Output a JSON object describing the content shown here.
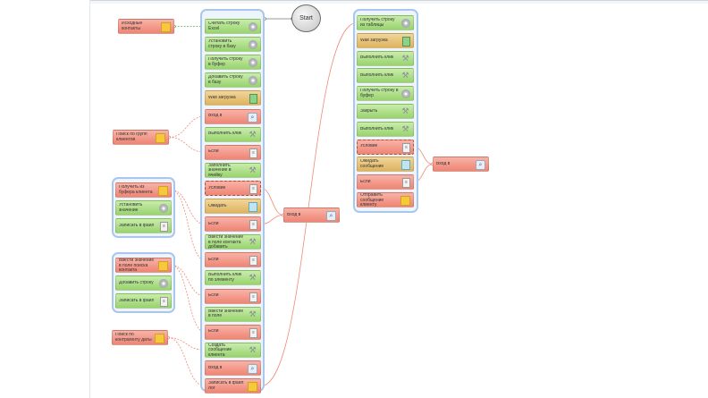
{
  "start": {
    "label": "Start"
  },
  "colors": {
    "green": "#a9dc7f",
    "red": "#f39385",
    "orange": "#e8c47a",
    "group_border": "#a9c7ea",
    "connector": "#f08a7a"
  },
  "left_notes": [
    {
      "id": "n1",
      "label": "Исходные контакты",
      "icon": "note-icon"
    },
    {
      "id": "n2",
      "label": "Поиск по групп клиентов",
      "icon": "note-icon"
    },
    {
      "id": "n3",
      "label": "Поиск по контрагенту даты",
      "icon": "note-icon"
    }
  ],
  "left_groups": [
    {
      "id": "g1",
      "items": [
        {
          "label": "Получить из буфера клиента",
          "color": "red",
          "icon": "note-icon"
        },
        {
          "label": "Установить значение",
          "color": "green",
          "icon": "disc-icon"
        },
        {
          "label": "Записать в файл",
          "color": "green",
          "icon": "document-icon"
        }
      ]
    },
    {
      "id": "g2",
      "items": [
        {
          "label": "Ввести значение в поле поиска контакта",
          "color": "red",
          "icon": "note-icon"
        },
        {
          "label": "Добавить строку",
          "color": "green",
          "icon": "disc-icon"
        },
        {
          "label": "Записать в файл",
          "color": "green",
          "icon": "document-icon"
        }
      ]
    }
  ],
  "main_column": [
    {
      "label": "Считать строку Excel",
      "color": "green",
      "icon": "disc-icon"
    },
    {
      "label": "Установить строку в базу",
      "color": "green",
      "icon": "disc-icon"
    },
    {
      "label": "Получить строку в буфер",
      "color": "green",
      "icon": "disc-icon"
    },
    {
      "label": "Добавить строку в базу",
      "color": "green",
      "icon": "disc-icon"
    },
    {
      "label": "Wait загрузка",
      "color": "orange",
      "icon": "drive-icon"
    },
    {
      "label": "Вход в",
      "color": "red",
      "icon": "search-icon"
    },
    {
      "label": "Выполнить клик",
      "color": "green",
      "icon": "wrench-icon"
    },
    {
      "label": "Если",
      "color": "red",
      "icon": "document-icon"
    },
    {
      "label": "Заполнить значение в ячейку",
      "color": "green",
      "icon": "wrench-icon"
    },
    {
      "label": "Условие",
      "color": "red",
      "icon": "document-icon",
      "dashed": true
    },
    {
      "label": "Ожидать",
      "color": "orange",
      "icon": "box-icon"
    },
    {
      "label": "Если",
      "color": "red",
      "icon": "document-icon"
    },
    {
      "label": "Ввести значение в поле контакта добавить",
      "color": "green",
      "icon": "wrench-icon"
    },
    {
      "label": "Если",
      "color": "red",
      "icon": "document-icon"
    },
    {
      "label": "Выполнить клик по элементу",
      "color": "green",
      "icon": "wrench-icon"
    },
    {
      "label": "Если",
      "color": "red",
      "icon": "document-icon"
    },
    {
      "label": "Ввести значение в поле",
      "color": "green",
      "icon": "wrench-icon"
    },
    {
      "label": "Если",
      "color": "red",
      "icon": "document-icon"
    },
    {
      "label": "Создать сообщение клиента",
      "color": "green",
      "icon": "wrench-icon"
    },
    {
      "label": "Вход в",
      "color": "red",
      "icon": "search-icon"
    },
    {
      "label": "Записать в файл лог",
      "color": "red",
      "icon": "note-icon"
    }
  ],
  "mid_node": {
    "label": "Вход в",
    "icon": "search-icon"
  },
  "right_column": [
    {
      "label": "Получить строку из таблицы",
      "color": "green",
      "icon": "disc-icon"
    },
    {
      "label": "Wait загрузка",
      "color": "orange",
      "icon": "drive-icon"
    },
    {
      "label": "Выполнить клик",
      "color": "green",
      "icon": "wrench-icon"
    },
    {
      "label": "Выполнить клик",
      "color": "green",
      "icon": "wrench-icon"
    },
    {
      "label": "Получить строку в буфер",
      "color": "green",
      "icon": "disc-icon"
    },
    {
      "label": "Закрыть",
      "color": "green",
      "icon": "wrench-icon"
    },
    {
      "label": "Выполнить клик",
      "color": "green",
      "icon": "wrench-icon"
    },
    {
      "label": "Условие",
      "color": "red",
      "icon": "document-icon",
      "dashed": true
    },
    {
      "label": "Ожидать сообщение",
      "color": "orange",
      "icon": "box-icon"
    },
    {
      "label": "Если",
      "color": "red",
      "icon": "document-icon"
    },
    {
      "label": "Отправить сообщение клиенту",
      "color": "red",
      "icon": "note-icon"
    }
  ],
  "right_node": {
    "label": "Вход в",
    "icon": "search-icon"
  }
}
